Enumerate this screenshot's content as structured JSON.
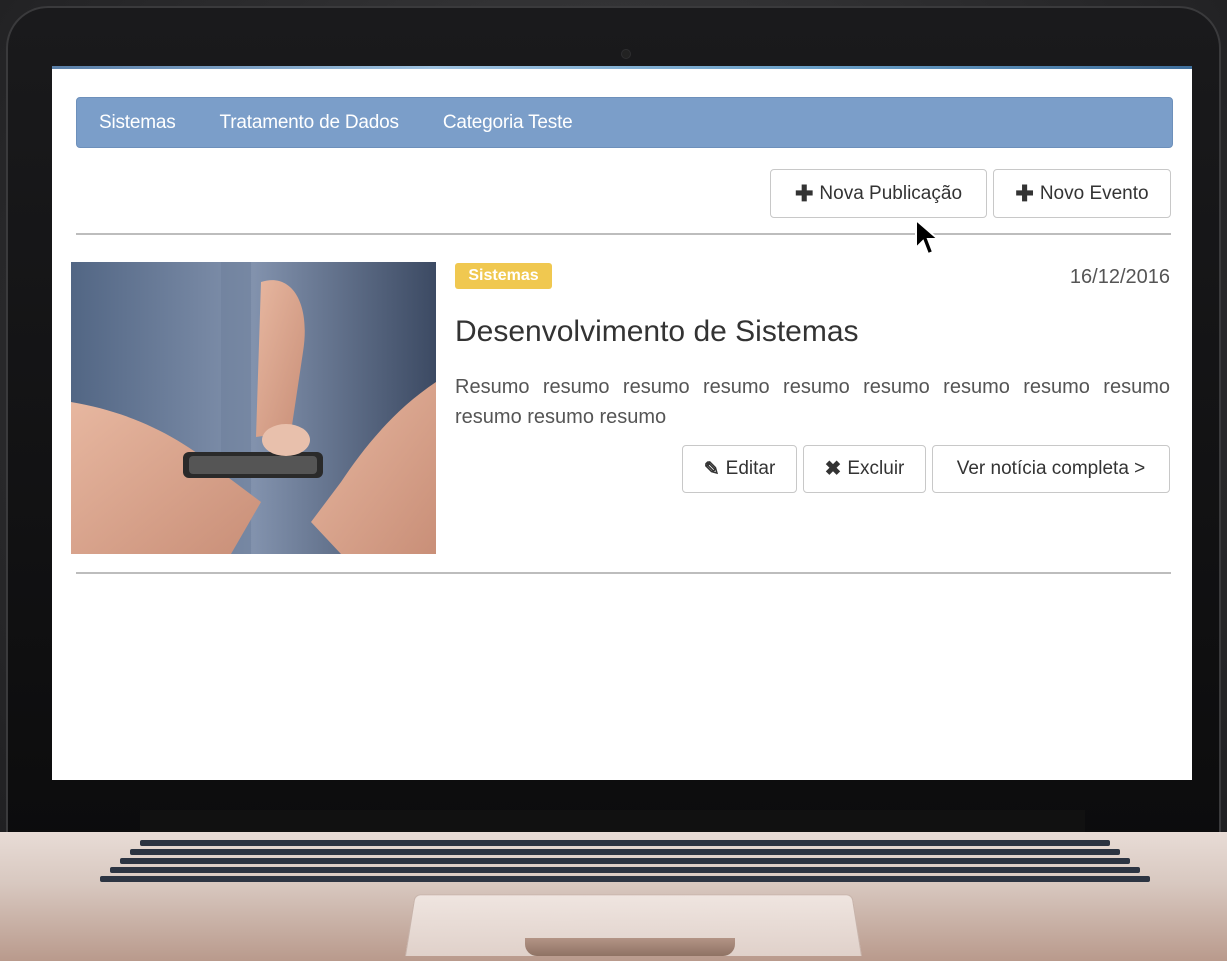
{
  "nav": {
    "items": [
      {
        "label": "Sistemas"
      },
      {
        "label": "Tratamento de Dados"
      },
      {
        "label": "Categoria Teste"
      }
    ]
  },
  "toolbar": {
    "new_post_label": "Nova Publicação",
    "new_event_label": "Novo Evento"
  },
  "post": {
    "category": "Sistemas",
    "date": "16/12/2016",
    "title": "Desenvolvimento de Sistemas",
    "summary": "Resumo resumo resumo resumo resumo resumo resumo resumo resumo resumo resumo resumo",
    "edit_label": "Editar",
    "delete_label": "Excluir",
    "read_more_label": "Ver notícia completa >"
  },
  "colors": {
    "navbar": "#7b9ec9",
    "badge": "#f0c850"
  },
  "icons": [
    "plus-icon",
    "edit-icon",
    "close-icon",
    "cursor-icon"
  ]
}
